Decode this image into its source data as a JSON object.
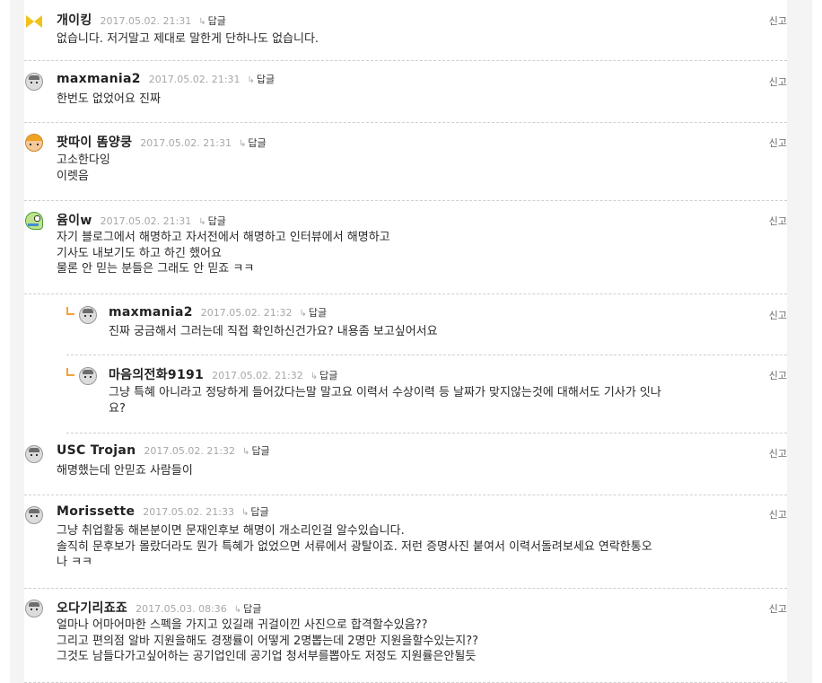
{
  "report_label": "신고",
  "reply_label": "답글",
  "comments": [
    {
      "nickname": "개이킹",
      "date": "2017.05.02. 21:31",
      "avatar_icon": "bow-avatar-icon",
      "text": "없습니다. 저거말고 제대로 말한게 단하나도 없습니다."
    },
    {
      "nickname": "maxmania2",
      "date": "2017.05.02. 21:31",
      "avatar_icon": "face-avatar-icon",
      "text": "한번도 없었어요 진짜"
    },
    {
      "nickname": "팟따이 똠양쿵",
      "date": "2017.05.02. 21:31",
      "avatar_icon": "girl-avatar-icon",
      "text": "고소한다잉\n이렛음"
    },
    {
      "nickname": "윰이w",
      "date": "2017.05.02. 21:31",
      "avatar_icon": "dino-avatar-icon",
      "text": "자기 블로그에서 해명하고 자서전에서 해명하고 인터뷰에서 해명하고\n기사도 내보기도 하고 하긴 했어요\n물론 안 믿는 분들은 그래도 안 믿죠 ㅋㅋ"
    },
    {
      "nickname": "maxmania2",
      "date": "2017.05.02. 21:32",
      "avatar_icon": "face-avatar-icon",
      "text": "진짜 궁금해서 그러는데 직접 확인하신건가요? 내용좀 보고싶어서요"
    },
    {
      "nickname": "마음의전화9191",
      "date": "2017.05.02. 21:32",
      "avatar_icon": "face-avatar-icon",
      "text": "그냥 특혜 아니라고 정당하게 들어갔다는말 말고요 이력서 수상이력 등 날짜가 맞지않는것에 대해서도 기사가 잇나\n요?"
    },
    {
      "nickname": "USC Trojan",
      "date": "2017.05.02. 21:32",
      "avatar_icon": "face-avatar-icon",
      "text": "해명했는데 안믿죠 사람들이"
    },
    {
      "nickname": "Morissette",
      "date": "2017.05.02. 21:33",
      "avatar_icon": "face-avatar-icon",
      "text": "그냥 취업활동 해본분이면 문재인후보 해명이 개소리인걸 알수있습니다.\n솔직히 문후보가 몰랐더라도 뭔가 특혜가 없었으면 서류에서 광탈이죠. 저런 증명사진 붙여서 이력서돌려보세요 연락한통오\n나 ㅋㅋ"
    },
    {
      "nickname": "오다기리죠죠",
      "date": "2017.05.03. 08:36",
      "avatar_icon": "face-avatar-icon",
      "text": "얼마나 어마어마한 스펙을 가지고 있길래 귀걸이낀 사진으로 합격할수있음??\n그리고 편의점 알바 지원을해도 경쟁률이 어떻게 2명뽑는데 2명만 지원을할수있는지??\n그것도 남들다가고싶어하는 공기업인데 공기업 청서부를뽑아도 저정도 지원률은안될듯"
    }
  ]
}
